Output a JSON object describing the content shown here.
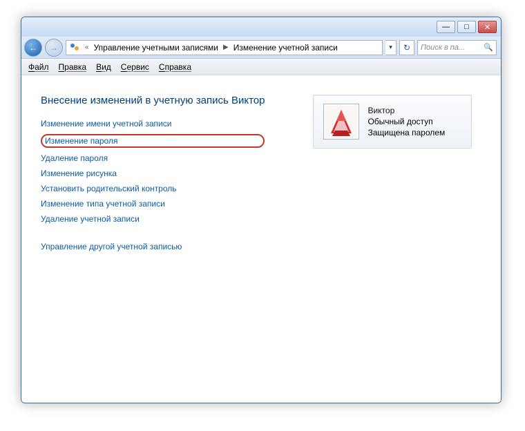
{
  "titlebar": {
    "min": "—",
    "max": "□",
    "close": "✕"
  },
  "breadcrumb": {
    "laquo": "«",
    "seg1": "Управление учетными записями",
    "seg2": "Изменение учетной записи"
  },
  "search": {
    "placeholder": "Поиск в па..."
  },
  "menubar": {
    "file": "Файл",
    "edit": "Правка",
    "view": "Вид",
    "service": "Сервис",
    "help": "Справка"
  },
  "heading": "Внесение изменений в учетную запись Виктор",
  "links": {
    "rename": "Изменение имени учетной записи",
    "changepw": "Изменение пароля",
    "removepw": "Удаление пароля",
    "picture": "Изменение рисунка",
    "parental": "Установить родительский контроль",
    "type": "Изменение типа учетной записи",
    "delete": "Удаление учетной записи",
    "other": "Управление другой учетной записью"
  },
  "user": {
    "name": "Виктор",
    "access": "Обычный доступ",
    "protected": "Защищена паролем"
  }
}
